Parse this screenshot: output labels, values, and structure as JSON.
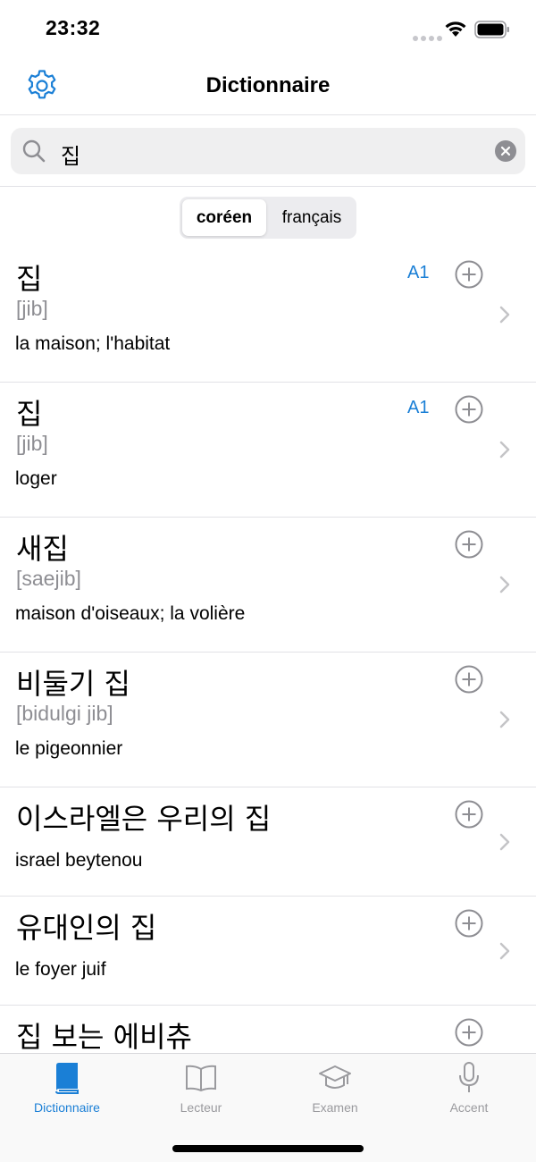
{
  "status_bar": {
    "time": "23:32"
  },
  "nav": {
    "title": "Dictionnaire",
    "settings_icon": "gear-icon"
  },
  "search": {
    "value": "집"
  },
  "segments": [
    {
      "label": "coréen",
      "selected": true
    },
    {
      "label": "français",
      "selected": false
    }
  ],
  "entries": [
    {
      "word": "집",
      "romaja": "[jib]",
      "meaning": "la maison; l'habitat",
      "level": "A1"
    },
    {
      "word": "집",
      "romaja": "[jib]",
      "meaning": "loger",
      "level": "A1"
    },
    {
      "word": "새집",
      "romaja": "[saejib]",
      "meaning": "maison d'oiseaux; la volière",
      "level": ""
    },
    {
      "word": "비둘기 집",
      "romaja": "[bidulgi jib]",
      "meaning": "le pigeonnier",
      "level": ""
    },
    {
      "word": "이스라엘은 우리의 집",
      "romaja": "",
      "meaning": "israel beytenou",
      "level": ""
    },
    {
      "word": "유대인의 집",
      "romaja": "",
      "meaning": "le foyer juif",
      "level": ""
    },
    {
      "word": "집 보는 에비츄",
      "romaja": "",
      "meaning": "",
      "level": ""
    }
  ],
  "tabs": [
    {
      "label": "Dictionnaire",
      "icon": "book-icon",
      "active": true
    },
    {
      "label": "Lecteur",
      "icon": "open-book-icon",
      "active": false
    },
    {
      "label": "Examen",
      "icon": "graduation-cap-icon",
      "active": false
    },
    {
      "label": "Accent",
      "icon": "microphone-icon",
      "active": false
    }
  ],
  "colors": {
    "accent": "#1a7fd6",
    "secondary_text": "#8e8e93",
    "separator": "#e2e2e6"
  }
}
